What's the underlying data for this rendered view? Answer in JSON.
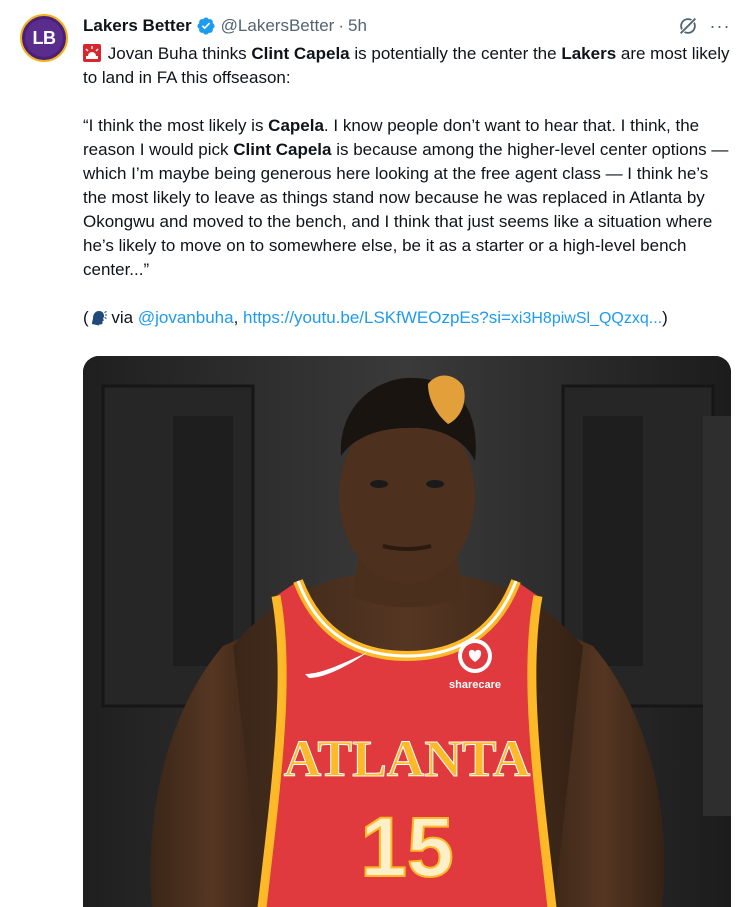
{
  "account": {
    "avatar_text": "LB",
    "name": "Lakers Better",
    "handle": "@LakersBetter",
    "separator": "·",
    "time": "5h"
  },
  "actions": {
    "more_label": "···"
  },
  "tweet": {
    "p1": {
      "a": "Jovan Buha thinks ",
      "b": "Clint Capela",
      "c": " is potentially the center the ",
      "d": "Lakers",
      "e": " are most likely to land in FA this offseason:"
    },
    "p2": {
      "a": "“I think the most likely is ",
      "b": "Capela",
      "c": ". I know people don’t want to hear that. I think, the reason I would pick ",
      "d": "Clint Capela",
      "e": " is because among the higher-level center options — which I’m maybe being generous here looking at the free agent class — I think he’s the most likely to leave as things stand now because he was replaced in Atlanta by Okongwu and moved to the bench, and I think that just seems like a situation where he’s likely to move on to somewhere else, be it as a starter or a high-level bench center...”"
    },
    "p3": {
      "open": "(",
      "via": " via ",
      "mention": "@jovanbuha",
      "comma": ", ",
      "url_main": "https://youtu.be/LSKfWEOzpEs?si=",
      "url_tail": "xi3H8piwSl_QQzxq...",
      "close": ")"
    }
  },
  "media": {
    "jersey_text": "ATLANTA",
    "jersey_number": "15",
    "sponsor": "sharecare"
  },
  "colors": {
    "verified": "#1d9bf0",
    "link": "#1d9bf0",
    "jersey_red": "#e03a3e",
    "jersey_gold": "#fdb927"
  }
}
